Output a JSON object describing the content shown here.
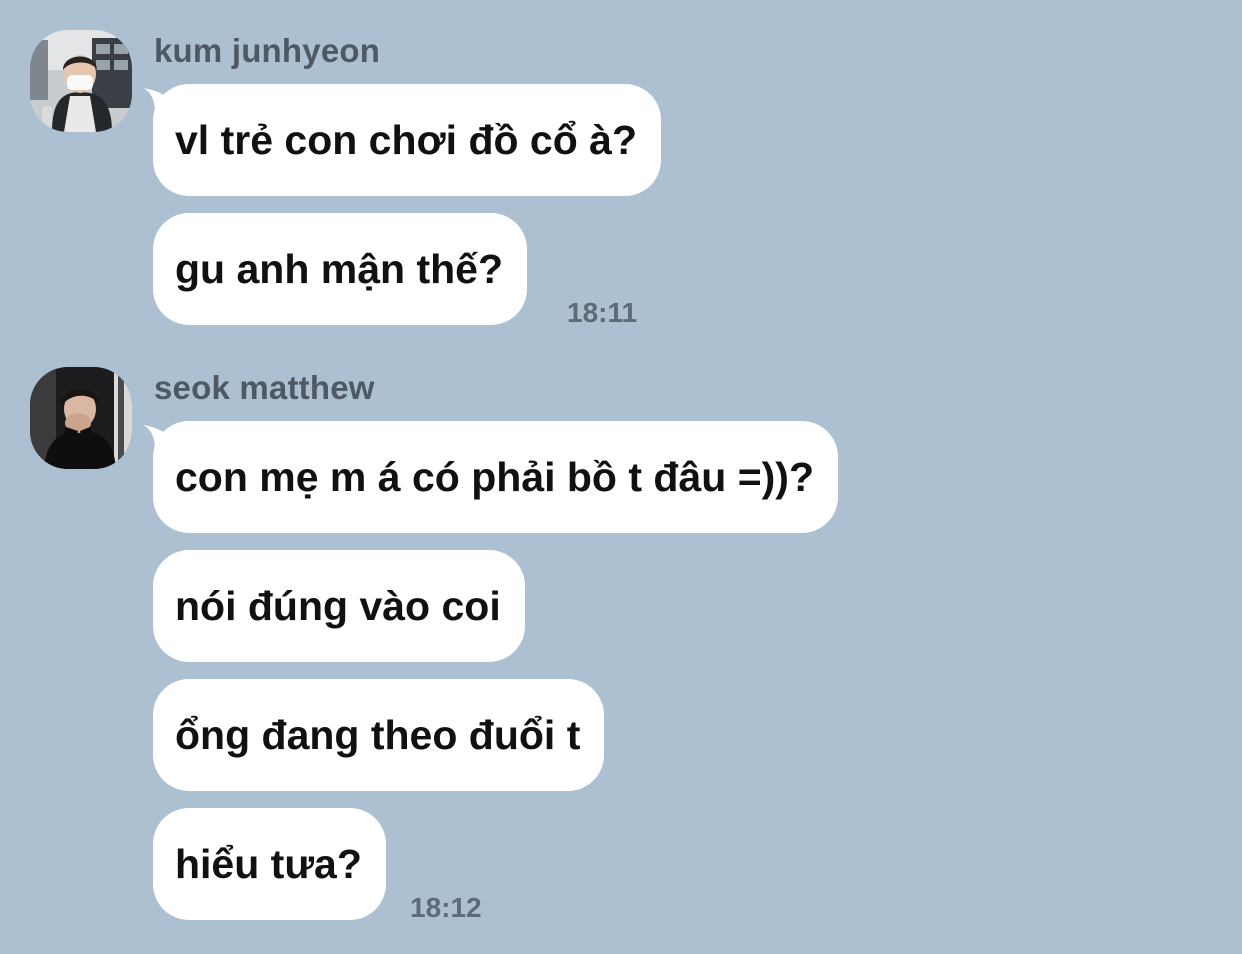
{
  "colors": {
    "background": "#adc0d1",
    "bubble": "#ffffff",
    "sender_name": "#4f5964",
    "timestamp": "#5e6a76"
  },
  "groups": [
    {
      "sender": "kum junhyeon",
      "avatar_icon": "user-avatar-photo-icon",
      "messages": [
        "vl trẻ con chơi đồ cổ à?",
        "gu anh mận thế?"
      ],
      "time": "18:11"
    },
    {
      "sender": "seok matthew",
      "avatar_icon": "user-avatar-photo-icon",
      "messages": [
        "con mẹ m á có phải bồ t đâu =))?",
        "nói đúng vào coi",
        "ổng đang theo đuổi t",
        "hiểu tưa?"
      ],
      "time": "18:12"
    }
  ]
}
